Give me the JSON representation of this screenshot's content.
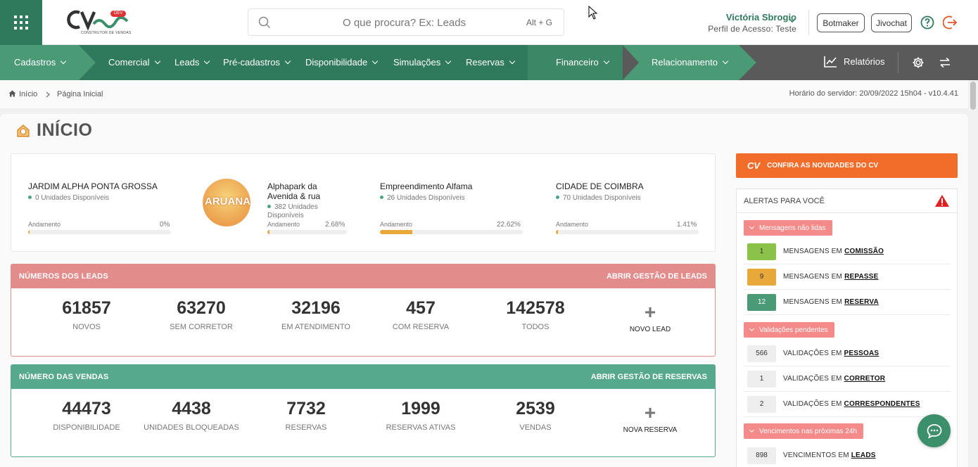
{
  "app": {
    "logo_text": "CV",
    "logo_badge": "DEV",
    "logo_subtitle": "CONSTRUTOR DE VENDAS"
  },
  "search": {
    "placeholder": "O que procura? Ex: Leads",
    "shortcut": "Alt + G"
  },
  "user": {
    "name": "Victória Sbrogio",
    "profile": "Perfil de Acesso: Teste"
  },
  "header_buttons": {
    "botmaker": "Botmaker",
    "jivochat": "Jivochat"
  },
  "nav": {
    "cadastros": "Cadastros",
    "comercial": "Comercial",
    "leads": "Leads",
    "pre_cadastros": "Pré-cadastros",
    "disponibilidade": "Disponibilidade",
    "simulacoes": "Simulações",
    "reservas": "Reservas",
    "financeiro": "Financeiro",
    "relacionamento": "Relacionamento",
    "relatorios": "Relatórios"
  },
  "breadcrumb": {
    "home": "Início",
    "current": "Página Inicial",
    "server_time": "Horário do servidor: 20/09/2022 15h04 - v10.4.41"
  },
  "page_title": "INÍCIO",
  "projects": [
    {
      "name": "JARDIM ALPHA PONTA GROSSA",
      "units": "0 Unidades Disponíveis",
      "progress_label": "Andamento",
      "progress": "0%",
      "progress_value": 0
    },
    {
      "name": "Alphapark da Avenida & rua",
      "units": "382 Unidades Disponíveis",
      "progress_label": "Andamento",
      "progress": "2.68%",
      "progress_value": 2.68,
      "logo_text": "ARUANA"
    },
    {
      "name": "Empreendimento Alfama",
      "units": "26 Unidades Disponíveis",
      "progress_label": "Andamento",
      "progress": "22.62%",
      "progress_value": 22.62
    },
    {
      "name": "CIDADE DE COIMBRA",
      "units": "70 Unidades Disponíveis",
      "progress_label": "Andamento",
      "progress": "1.41%",
      "progress_value": 1.41
    }
  ],
  "leads_panel": {
    "title": "NÚMEROS DOS LEADS",
    "link": "ABRIR GESTÃO DE LEADS",
    "color": "#e28c8c",
    "stats": [
      {
        "value": "61857",
        "label": "NOVOS"
      },
      {
        "value": "63270",
        "label": "SEM CORRETOR"
      },
      {
        "value": "32196",
        "label": "EM ATENDIMENTO"
      },
      {
        "value": "457",
        "label": "COM RESERVA"
      },
      {
        "value": "142578",
        "label": "TODOS"
      }
    ],
    "new_label": "NOVO LEAD"
  },
  "sales_panel": {
    "title": "NÚMERO DAS VENDAS",
    "link": "ABRIR GESTÃO DE RESERVAS",
    "color": "#57a98d",
    "stats": [
      {
        "value": "44473",
        "label": "DISPONIBILIDADE"
      },
      {
        "value": "4438",
        "label": "UNIDADES BLOQUEADAS"
      },
      {
        "value": "7732",
        "label": "RESERVAS"
      },
      {
        "value": "1999",
        "label": "RESERVAS ATIVAS"
      },
      {
        "value": "2539",
        "label": "VENDAS"
      }
    ],
    "new_label": "NOVA RESERVA"
  },
  "news": {
    "icon_text": "CV",
    "label": "CONFIRA AS NOVIDADES DO CV"
  },
  "alerts": {
    "title": "ALERTAS PARA VOCÊ",
    "groups": [
      {
        "label": "Mensagens não lidas",
        "rows": [
          {
            "count": "1",
            "prefix": "MENSAGENS EM",
            "link": "COMISSÃO",
            "color": "#8bc34a"
          },
          {
            "count": "9",
            "prefix": "MENSAGENS EM",
            "link": "REPASSE",
            "color": "#e8a83a"
          },
          {
            "count": "12",
            "prefix": "MENSAGENS EM",
            "link": "RESERVA",
            "color": "#4a9a76"
          }
        ]
      },
      {
        "label": "Validações pendentes",
        "rows": [
          {
            "count": "566",
            "prefix": "VALIDAÇÕES EM",
            "link": "PESSOAS",
            "color": "#eeeeee"
          },
          {
            "count": "1",
            "prefix": "VALIDAÇÕES EM",
            "link": "CORRETOR",
            "color": "#eeeeee"
          },
          {
            "count": "2",
            "prefix": "VALIDAÇÕES EM",
            "link": "CORRESPONDENTES",
            "color": "#eeeeee"
          }
        ]
      },
      {
        "label": "Vencimentos nas próximas 24h",
        "rows": [
          {
            "count": "898",
            "prefix": "VENCIMENTOS EM",
            "link": "LEADS",
            "color": "#eeeeee"
          }
        ]
      }
    ]
  },
  "colors": {
    "brand_green": "#2f7a5c",
    "nav_gray": "#5a5a5a",
    "accent_orange": "#f26c2a",
    "alert_red": "#e02020"
  }
}
